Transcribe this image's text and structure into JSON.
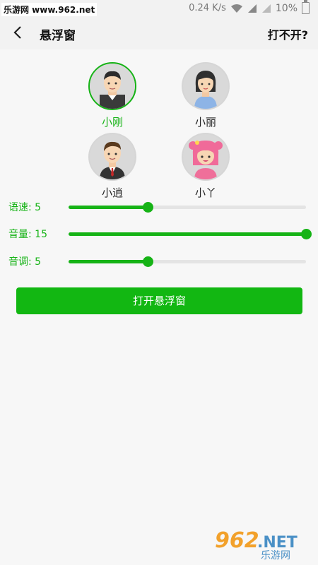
{
  "status_bar": {
    "watermark": "乐游网 www.962.net",
    "speed": "0.24 K/s",
    "battery": "10%"
  },
  "app_bar": {
    "title": "悬浮窗",
    "help": "打不开?"
  },
  "voices": [
    {
      "name": "小刚",
      "selected": true
    },
    {
      "name": "小丽",
      "selected": false
    },
    {
      "name": "小逍",
      "selected": false
    },
    {
      "name": "小丫",
      "selected": false
    }
  ],
  "sliders": [
    {
      "label": "语速:  5",
      "value": 5,
      "max": 15
    },
    {
      "label": "音量:  15",
      "value": 15,
      "max": 15
    },
    {
      "label": "音调:  5",
      "value": 5,
      "max": 15
    }
  ],
  "main_button": "打开悬浮窗",
  "footer_logo": {
    "number": "962",
    "domain": ".NET",
    "cn": "乐游网"
  },
  "colors": {
    "accent": "#16b316",
    "button": "#12b712"
  }
}
